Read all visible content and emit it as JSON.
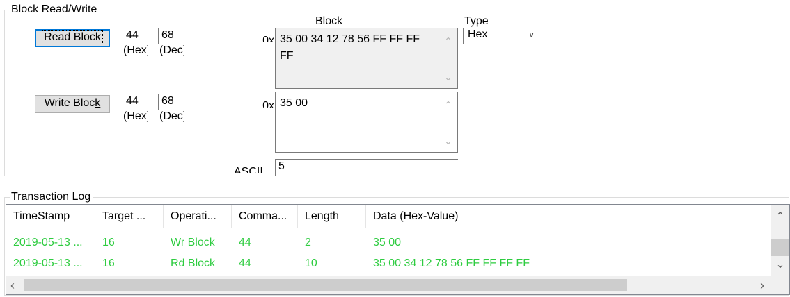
{
  "block_rw": {
    "title": "Block Read/Write",
    "block_header": "Block",
    "type_header": "Type",
    "read_button": "Read Block",
    "write_button_pre": "Write Bloc",
    "write_button_mnemonic": "k",
    "read_hex_value": "44",
    "read_dec_value": "68",
    "write_hex_value": "44",
    "write_dec_value": "68",
    "hex_label": "(Hex)",
    "dec_label": "(Dec)",
    "prefix_0x": "0x",
    "read_data": "35 00 34 12 78 56 FF FF FF FF",
    "write_data": "35 00",
    "ascii_label": "ASCII",
    "ascii_value": "5",
    "type_selected": "Hex"
  },
  "log": {
    "title": "Transaction Log",
    "columns": [
      "TimeStamp",
      "Target ...",
      "Operati...",
      "Comma...",
      "Length",
      "Data (Hex-Value)"
    ],
    "rows": [
      [
        "2019-05-13 ...",
        "16",
        "Wr Block",
        "44",
        "2",
        "35 00"
      ],
      [
        "2019-05-13 ...",
        "16",
        "Rd Block",
        "44",
        "10",
        "35 00 34 12 78 56 FF FF FF FF"
      ]
    ],
    "row_color": "#2ecc40"
  }
}
